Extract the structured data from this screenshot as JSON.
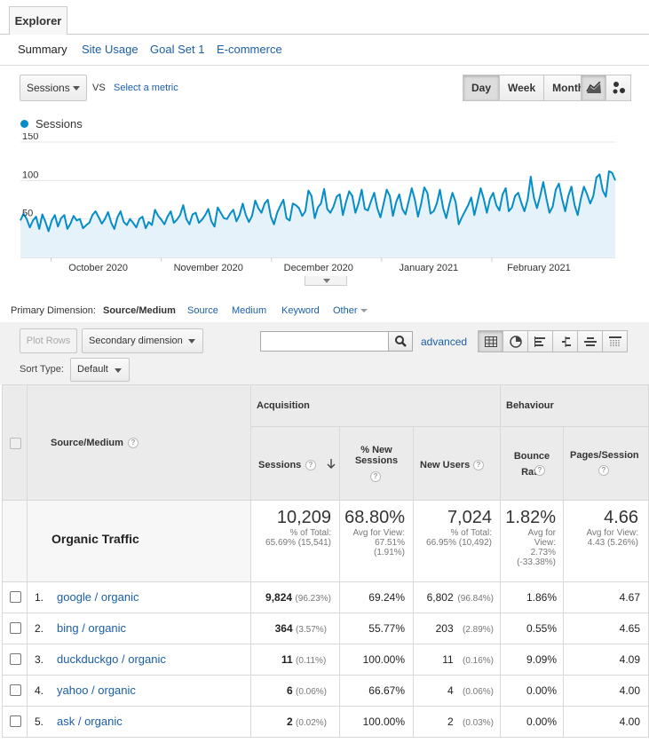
{
  "explorer_tab": "Explorer",
  "subtabs": [
    "Summary",
    "Site Usage",
    "Goal Set 1",
    "E-commerce"
  ],
  "metric_selector": {
    "value": "Sessions",
    "vs": "VS",
    "select_metric": "Select a metric"
  },
  "granularity": [
    "Day",
    "Week",
    "Month"
  ],
  "granularity_active": "Day",
  "chart_type_buttons": [
    "line-chart-icon",
    "motion-chart-icon"
  ],
  "legend": {
    "series": "Sessions",
    "color": "#058dc7"
  },
  "chart_data": {
    "type": "area",
    "series": [
      {
        "name": "Sessions",
        "values": [
          48,
          57,
          50,
          39,
          48,
          53,
          37,
          56,
          46,
          34,
          48,
          55,
          40,
          51,
          55,
          37,
          44,
          54,
          48,
          50,
          38,
          42,
          45,
          55,
          60,
          52,
          44,
          50,
          59,
          45,
          37,
          52,
          60,
          46,
          42,
          50,
          45,
          39,
          50,
          53,
          38,
          46,
          42,
          62,
          54,
          49,
          43,
          53,
          60,
          45,
          49,
          55,
          68,
          50,
          43,
          56,
          58,
          45,
          49,
          55,
          63,
          47,
          40,
          65,
          58,
          51,
          50,
          57,
          62,
          47,
          55,
          70,
          55,
          46,
          54,
          74,
          64,
          58,
          70,
          75,
          53,
          43,
          58,
          67,
          75,
          51,
          48,
          70,
          68,
          64,
          54,
          60,
          87,
          80,
          51,
          65,
          70,
          89,
          63,
          58,
          66,
          79,
          82,
          55,
          72,
          86,
          80,
          58,
          70,
          88,
          63,
          61,
          73,
          84,
          64,
          52,
          70,
          88,
          80,
          54,
          72,
          82,
          63,
          56,
          73,
          90,
          75,
          53,
          70,
          91,
          84,
          57,
          60,
          70,
          88,
          64,
          51,
          69,
          84,
          72,
          43,
          52,
          60,
          68,
          78,
          55,
          72,
          90,
          76,
          58,
          76,
          84,
          68,
          61,
          82,
          90,
          60,
          65,
          80,
          84,
          71,
          60,
          75,
          105,
          78,
          64,
          80,
          98,
          77,
          58,
          66,
          88,
          96,
          76,
          60,
          80,
          92,
          68,
          55,
          76,
          92,
          82,
          70,
          80,
          104,
          108,
          87,
          79,
          112,
          110,
          100
        ]
      }
    ],
    "x_tick_labels": [
      "October 2020",
      "November 2020",
      "December 2020",
      "January 2021",
      "February 2021"
    ],
    "y_tick_labels": [
      "150",
      "100",
      "50"
    ],
    "ylim": [
      0,
      150
    ],
    "grid": true,
    "legend_position": "top-left"
  },
  "primary_dimension": {
    "label": "Primary Dimension:",
    "current": "Source/Medium",
    "options": [
      "Source",
      "Medium",
      "Keyword",
      "Other"
    ]
  },
  "toolbar": {
    "plot_rows": "Plot Rows",
    "secondary_dimension": "Secondary dimension",
    "search_placeholder": "",
    "advanced": "advanced",
    "view_icons": [
      "table-view-icon",
      "pie-view-icon",
      "performance-view-icon",
      "comparison-view-icon",
      "term-cloud-view-icon",
      "pivot-view-icon"
    ],
    "sort_type_label": "Sort Type:",
    "sort_type_value": "Default"
  },
  "table": {
    "dimension_header": "Source/Medium",
    "group_headers": [
      "Acquisition",
      "Behaviour"
    ],
    "columns": [
      "Sessions",
      "% New Sessions",
      "New Users",
      "Bounce Rate",
      "Pages/Session"
    ],
    "summary": {
      "label": "Organic Traffic",
      "sessions": {
        "value": "10,209",
        "sub1": "% of Total:",
        "sub2": "65.69% (15,541)"
      },
      "new_sessions": {
        "value": "68.80%",
        "sub1": "Avg for View:",
        "sub2": "67.51%",
        "sub3": "(1.91%)"
      },
      "new_users": {
        "value": "7,024",
        "sub1": "% of Total:",
        "sub2": "66.95% (10,492)"
      },
      "bounce": {
        "value": "1.82%",
        "sub1": "Avg for",
        "sub2": "View:",
        "sub3": "2.73%",
        "sub4": "(-33.38%)"
      },
      "pages": {
        "value": "4.66",
        "sub1": "Avg for View:",
        "sub2": "4.43 (5.26%)"
      }
    },
    "rows": [
      {
        "num": "1.",
        "source": "google / organic",
        "sessions": "9,824",
        "sessions_pct": "(96.23%)",
        "new_sessions": "69.24%",
        "new_users": "6,802",
        "new_users_pct": "(96.84%)",
        "bounce": "1.86%",
        "pages": "4.67"
      },
      {
        "num": "2.",
        "source": "bing / organic",
        "sessions": "364",
        "sessions_pct": "(3.57%)",
        "new_sessions": "55.77%",
        "new_users": "203",
        "new_users_pct": "(2.89%)",
        "bounce": "0.55%",
        "pages": "4.65"
      },
      {
        "num": "3.",
        "source": "duckduckgo / organic",
        "sessions": "11",
        "sessions_pct": "(0.11%)",
        "new_sessions": "100.00%",
        "new_users": "11",
        "new_users_pct": "(0.16%)",
        "bounce": "9.09%",
        "pages": "4.09"
      },
      {
        "num": "4.",
        "source": "yahoo / organic",
        "sessions": "6",
        "sessions_pct": "(0.06%)",
        "new_sessions": "66.67%",
        "new_users": "4",
        "new_users_pct": "(0.06%)",
        "bounce": "0.00%",
        "pages": "4.00"
      },
      {
        "num": "5.",
        "source": "ask / organic",
        "sessions": "2",
        "sessions_pct": "(0.02%)",
        "new_sessions": "100.00%",
        "new_users": "2",
        "new_users_pct": "(0.03%)",
        "bounce": "0.00%",
        "pages": "4.00"
      }
    ]
  }
}
